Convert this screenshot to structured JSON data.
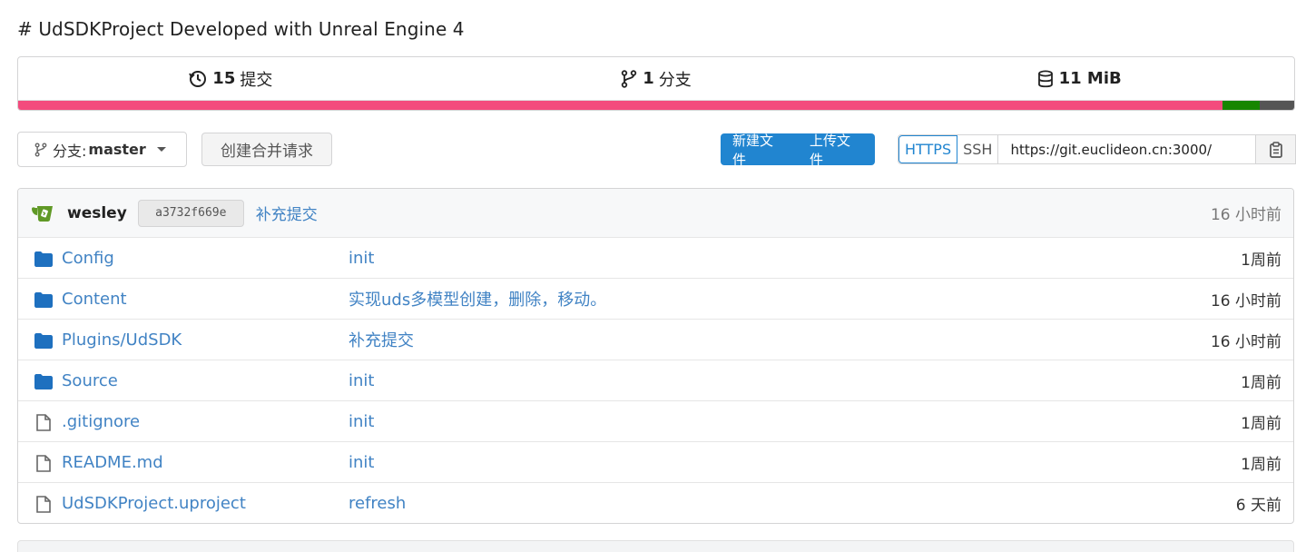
{
  "description": "# UdSDKProject Developed with Unreal Engine 4",
  "stats": {
    "commits_count": "15",
    "commits_label": "提交",
    "branches_count": "1",
    "branches_label": "分支",
    "size": "11 MiB"
  },
  "languages": [
    {
      "color": "#f34b7d",
      "percent": 94.4
    },
    {
      "color": "#178600",
      "percent": 2.9
    },
    {
      "color": "#555555",
      "percent": 2.7
    }
  ],
  "toolbar": {
    "branch_prefix": "分支:",
    "branch_name": "master",
    "pull_request_label": "创建合并请求",
    "new_file_label": "新建文件",
    "upload_file_label": "上传文件",
    "https_label": "HTTPS",
    "ssh_label": "SSH",
    "clone_url": "https://git.euclideon.cn:3000/"
  },
  "latest_commit": {
    "author": "wesley",
    "sha": "a3732f669e",
    "message": "补充提交",
    "time": "16 小时前"
  },
  "files": [
    {
      "type": "folder",
      "name": "Config",
      "message": "init",
      "time": "1周前"
    },
    {
      "type": "folder",
      "name": "Content",
      "message": "实现uds多模型创建，删除，移动。",
      "time": "16 小时前"
    },
    {
      "type": "folder",
      "name": "Plugins/UdSDK",
      "message": "补充提交",
      "time": "16 小时前"
    },
    {
      "type": "folder",
      "name": "Source",
      "message": "init",
      "time": "1周前"
    },
    {
      "type": "file",
      "name": ".gitignore",
      "message": "init",
      "time": "1周前"
    },
    {
      "type": "file",
      "name": "README.md",
      "message": "init",
      "time": "1周前"
    },
    {
      "type": "file",
      "name": "UdSDKProject.uproject",
      "message": "refresh",
      "time": "6 天前"
    }
  ]
}
